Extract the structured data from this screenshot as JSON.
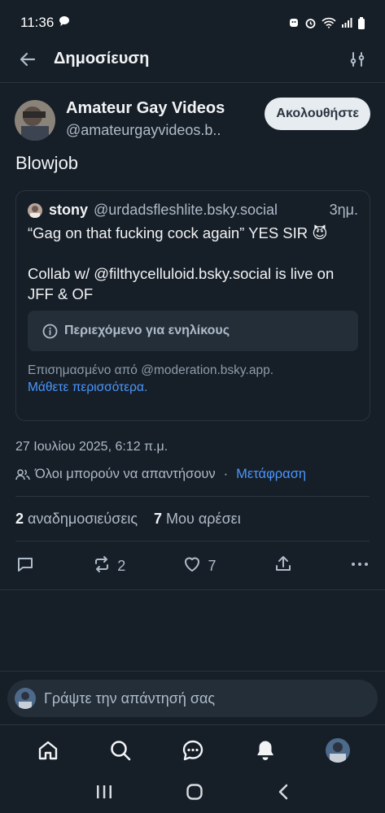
{
  "status_bar": {
    "time": "11:36"
  },
  "header": {
    "title": "Δημοσίευση"
  },
  "post": {
    "author_name": "Amateur Gay Videos",
    "author_handle": "@amateurgayvideos.b..",
    "follow_label": "Ακολουθήστε",
    "text": "Blowjob",
    "date": "27 Ιουλίου 2025, 6:12 π.μ.",
    "reply_setting": "Όλοι μπορούν να απαντήσουν",
    "separator": "·",
    "translate_label": "Μετάφραση"
  },
  "quote": {
    "name": "stony",
    "handle": "@urdadsfleshlite.bsky.social",
    "time": "3ημ.",
    "body": "“Gag on that fucking cock again” YES SIR 😈\n\nCollab w/ @filthycelluloid.bsky.social is live on JFF & OF",
    "warning": "Περιεχόμενο για ενηλίκους",
    "moderation": "Επισημασμένο από @moderation.bsky.app.",
    "learn_more": "Μάθετε περισσότερα."
  },
  "stats": {
    "reposts_count": "2",
    "reposts_label": "αναδημοσιεύσεις",
    "likes_count": "7",
    "likes_label": "Μου αρέσει"
  },
  "actions": {
    "repost_count": "2",
    "like_count": "7"
  },
  "composer": {
    "placeholder": "Γράψτε την απάντησή σας"
  },
  "colors": {
    "background": "#161e27",
    "accent": "#4b97ff",
    "muted": "#aebbc9",
    "border": "#2a3440"
  },
  "icons": [
    "back-arrow-icon",
    "filter-icon",
    "info-icon",
    "people-icon",
    "reply-icon",
    "repost-icon",
    "heart-icon",
    "share-icon",
    "more-icon",
    "home-icon",
    "search-icon",
    "chat-icon",
    "bell-icon"
  ]
}
